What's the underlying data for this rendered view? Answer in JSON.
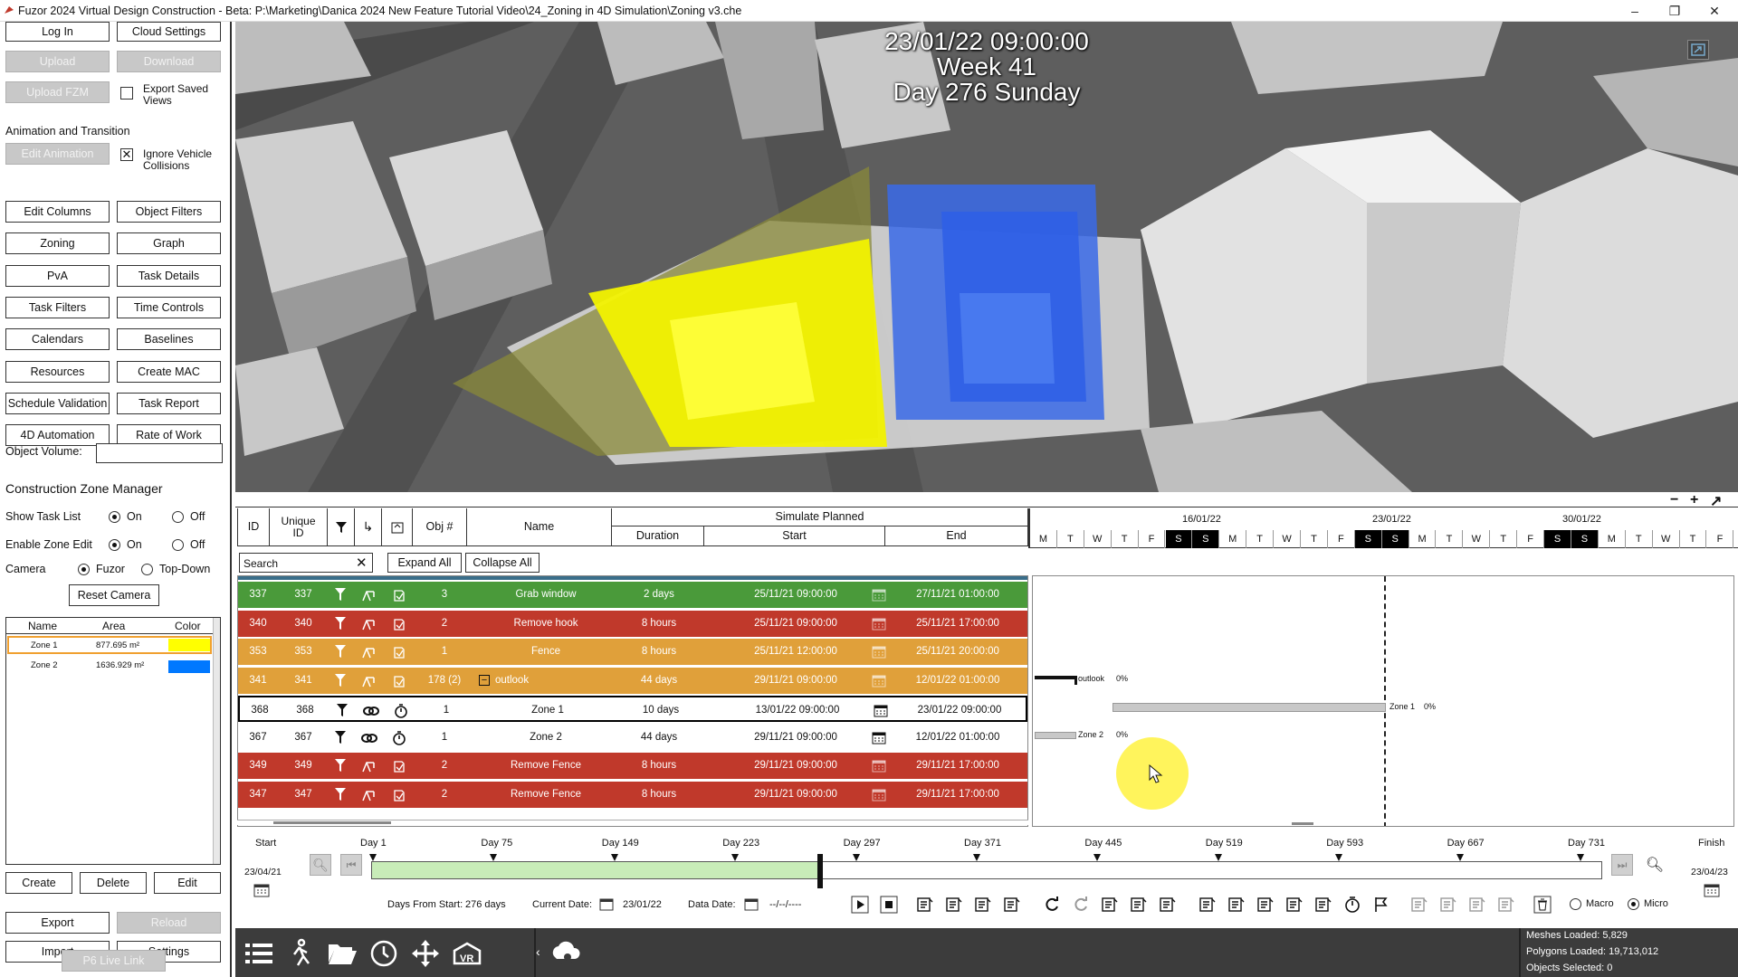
{
  "window": {
    "title": "Fuzor 2024 Virtual Design Construction - Beta: P:\\Marketing\\Danica 2024 New Feature Tutorial Video\\24_Zoning in 4D Simulation\\Zoning v3.che",
    "minimize": "–",
    "restore": "❐",
    "close": "✕"
  },
  "left": {
    "log_in": "Log In",
    "cloud_settings": "Cloud Settings",
    "upload": "Upload",
    "download": "Download",
    "upload_fzm": "Upload FZM",
    "export_saved_views": "Export Saved Views",
    "anim_section": "Animation and Transition",
    "edit_animation": "Edit Animation",
    "ignore_vehicle": "Ignore Vehicle Collisions",
    "ignore_vehicle_mark": "✕",
    "buttons": [
      "Edit Columns",
      "Object Filters",
      "Zoning",
      "Graph",
      "PvA",
      "Task Details",
      "Task Filters",
      "Time Controls",
      "Calendars",
      "Baselines",
      "Resources",
      "Create MAC",
      "Schedule Validation",
      "Task Report",
      "4D Automation",
      "Rate of Work"
    ],
    "object_volume": "Object Volume:",
    "object_volume_value": "",
    "czm_title": "Construction Zone Manager",
    "show_task_list": "Show Task List",
    "enable_zone_edit": "Enable Zone Edit",
    "camera": "Camera",
    "on": "On",
    "off": "Off",
    "fuzor": "Fuzor",
    "top_down": "Top-Down",
    "reset_camera": "Reset Camera",
    "zone_cols": [
      "Name",
      "Area",
      "Color"
    ],
    "zones": [
      {
        "name": "Zone 1",
        "area": "877.695 m²",
        "color": "#ffff00"
      },
      {
        "name": "Zone 2",
        "area": "1636.929 m²",
        "color": "#0078ff"
      }
    ],
    "create": "Create",
    "delete": "Delete",
    "edit": "Edit",
    "export": "Export",
    "reload": "Reload",
    "import": "Import",
    "settings": "Settings",
    "p6_live_link": "P6 Live Link"
  },
  "view": {
    "datetime": "23/01/22 09:00:00",
    "week": "Week 41",
    "day": "Day 276 Sunday"
  },
  "schedule": {
    "cols": {
      "id": "ID",
      "unique_id": "Unique ID",
      "obj": "Obj #",
      "name": "Name",
      "simulate": "Simulate Planned",
      "duration": "Duration",
      "start": "Start",
      "end": "End"
    },
    "search_placeholder": "Search",
    "expand_all": "Expand All",
    "collapse_all": "Collapse All",
    "dates": [
      "16/01/22",
      "23/01/22",
      "30/01/22"
    ],
    "days": [
      "M",
      "T",
      "W",
      "T",
      "F",
      "S",
      "S",
      "M",
      "T",
      "W",
      "T",
      "F",
      "S",
      "S",
      "M",
      "T",
      "W",
      "T",
      "F",
      "S",
      "S",
      "M",
      "T",
      "W",
      "T",
      "F"
    ],
    "rows": [
      {
        "id": "337",
        "uid": "337",
        "obj": "3",
        "name": "Grab window",
        "duration": "2 days",
        "start": "25/11/21 09:00:00",
        "end": "27/11/21 01:00:00",
        "color": "#4a9a3a",
        "fg": "#ffffff"
      },
      {
        "id": "340",
        "uid": "340",
        "obj": "2",
        "name": "Remove hook",
        "duration": "8 hours",
        "start": "25/11/21 09:00:00",
        "end": "25/11/21 17:00:00",
        "color": "#c0392b",
        "fg": "#ffffff"
      },
      {
        "id": "353",
        "uid": "353",
        "obj": "1",
        "name": "Fence",
        "duration": "8 hours",
        "start": "25/11/21 12:00:00",
        "end": "25/11/21 20:00:00",
        "color": "#e0a03a",
        "fg": "#ffffff"
      },
      {
        "id": "341",
        "uid": "341",
        "obj": "178 (2)",
        "name": "outlook",
        "duration": "44 days",
        "start": "29/11/21 09:00:00",
        "end": "12/01/22 01:00:00",
        "color": "#e0a03a",
        "fg": "#ffffff"
      },
      {
        "id": "368",
        "uid": "368",
        "obj": "1",
        "name": "Zone 1",
        "duration": "10 days",
        "start": "13/01/22 09:00:00",
        "end": "23/01/22 09:00:00",
        "color": "#ffffff",
        "fg": "#111111"
      },
      {
        "id": "367",
        "uid": "367",
        "obj": "1",
        "name": "Zone 2",
        "duration": "44 days",
        "start": "29/11/21 09:00:00",
        "end": "12/01/22 01:00:00",
        "color": "#ffffff",
        "fg": "#111111"
      },
      {
        "id": "349",
        "uid": "349",
        "obj": "2",
        "name": "Remove Fence",
        "duration": "8 hours",
        "start": "29/11/21 09:00:00",
        "end": "29/11/21 17:00:00",
        "color": "#c0392b",
        "fg": "#ffffff"
      },
      {
        "id": "347",
        "uid": "347",
        "obj": "2",
        "name": "Remove Fence",
        "duration": "8 hours",
        "start": "29/11/21 09:00:00",
        "end": "29/11/21 17:00:00",
        "color": "#c0392b",
        "fg": "#ffffff"
      }
    ],
    "gantt": {
      "outlook_label": "outlook",
      "outlook_pct": "0%",
      "zone1_label": "Zone 1",
      "zone1_pct": "0%",
      "zone2_label": "Zone 2",
      "zone2_pct": "0%"
    }
  },
  "timeline": {
    "start": "Start",
    "finish": "Finish",
    "start_date": "23/04/21",
    "finish_date": "23/04/23",
    "ticks": [
      "Day 1",
      "Day 75",
      "Day 149",
      "Day 223",
      "Day 297",
      "Day 371",
      "Day 445",
      "Day 519",
      "Day 593",
      "Day 667",
      "Day 731"
    ],
    "progress": 0.37,
    "days_from_start_label": "Days From Start:",
    "days_from_start": "276 days",
    "current_date_label": "Current Date:",
    "current_date": "23/01/22",
    "data_date_label": "Data Date:",
    "data_date": "--/--/----",
    "macro": "Macro",
    "micro": "Micro"
  },
  "status": {
    "meshes": "Meshes Loaded: 5,829",
    "polygons": "Polygons Loaded: 19,713,012",
    "objects": "Objects Selected: 0"
  },
  "colors": {
    "green": "#4a9a3a",
    "red": "#c0392b",
    "orange": "#e0a03a",
    "zone_yellow": "#ffff00",
    "zone_blue": "#0078ff"
  }
}
